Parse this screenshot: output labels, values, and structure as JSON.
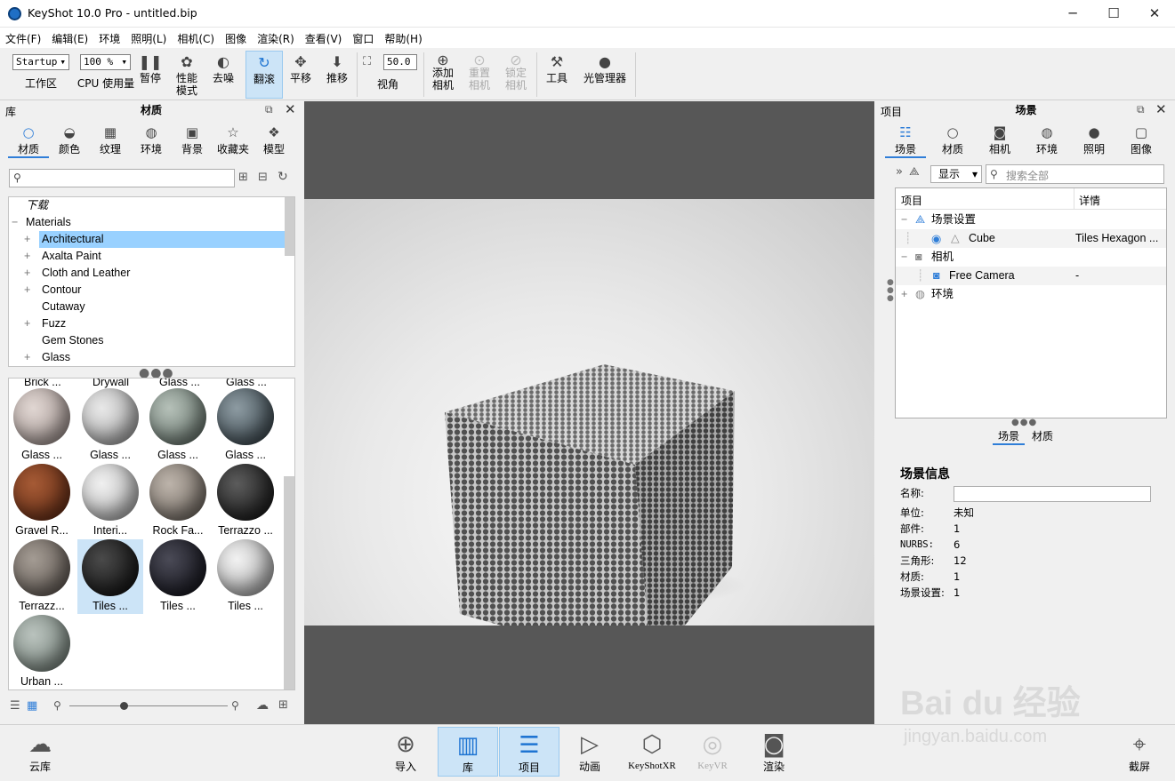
{
  "window": {
    "title": "KeyShot 10.0 Pro  - untitled.bip",
    "minimize": "─",
    "maximize": "☐",
    "close": "✕"
  },
  "menu": [
    "文件(F)",
    "编辑(E)",
    "环境",
    "照明(L)",
    "相机(C)",
    "图像",
    "渲染(R)",
    "查看(V)",
    "窗口",
    "帮助(H)"
  ],
  "toolbar": {
    "workspace_value": "Startup",
    "workspace_label": "工作区",
    "cpu_value": "100 %",
    "cpu_label": "CPU 使用量",
    "pause": "暂停",
    "perf_mode_1": "性能",
    "perf_mode_2": "模式",
    "denoise": "去噪",
    "flip": "翻滚",
    "pan": "平移",
    "dolly": "推移",
    "fov_value": "50.0",
    "fov_label": "视角",
    "add_camera_1": "添加",
    "add_camera_2": "相机",
    "reset_camera_1": "重置",
    "reset_camera_2": "相机",
    "lock_camera_1": "锁定",
    "lock_camera_2": "相机",
    "tools": "工具",
    "light_manager": "光管理器"
  },
  "library": {
    "header_left": "库",
    "title": "材质",
    "tabs": [
      "材质",
      "颜色",
      "纹理",
      "环境",
      "背景",
      "收藏夹",
      "模型"
    ],
    "search_placeholder": "",
    "tree": [
      {
        "label": "下载",
        "pm": ""
      },
      {
        "label": "Materials",
        "pm": "−"
      },
      {
        "label": "Architectural",
        "pm": "+"
      },
      {
        "label": "Axalta Paint",
        "pm": "+"
      },
      {
        "label": "Cloth and Leather",
        "pm": "+"
      },
      {
        "label": "Contour",
        "pm": "+"
      },
      {
        "label": "Cutaway",
        "pm": ""
      },
      {
        "label": "Fuzz",
        "pm": "+"
      },
      {
        "label": "Gem Stones",
        "pm": ""
      },
      {
        "label": "Glass",
        "pm": "+"
      }
    ],
    "top_row_labels": [
      "Brick ...",
      "Drywall",
      "Glass ...",
      "Glass ..."
    ],
    "thumbs": [
      "Glass ...",
      "Glass ...",
      "Glass ...",
      "Glass ...",
      "Gravel R...",
      "Interi...",
      "Rock Fa...",
      "Terrazzo ...",
      "Terrazz...",
      "Tiles ...",
      "Tiles ...",
      "Tiles ...",
      "Urban ..."
    ]
  },
  "project": {
    "header_left": "项目",
    "title": "场景",
    "tabs": [
      "场景",
      "材质",
      "相机",
      "环境",
      "照明",
      "图像"
    ],
    "show_value": "显示",
    "search_placeholder": "搜索全部",
    "col_item": "项目",
    "col_detail": "详情",
    "rows": {
      "scene_settings": "场景设置",
      "cube": "Cube",
      "cube_detail": "Tiles Hexagon ...",
      "cameras": "相机",
      "free_camera": "Free Camera",
      "free_camera_detail": "-",
      "environment": "环境"
    },
    "subtabs": [
      "场景",
      "材质"
    ],
    "info_title": "场景信息",
    "info": [
      {
        "k": "名称:",
        "v": ""
      },
      {
        "k": "单位:",
        "v": "未知"
      },
      {
        "k": "部件:",
        "v": "1"
      },
      {
        "k": "NURBS:",
        "v": "6"
      },
      {
        "k": "三角形:",
        "v": "12"
      },
      {
        "k": "材质:",
        "v": "1"
      },
      {
        "k": "场景设置:",
        "v": "1"
      }
    ]
  },
  "bottom": {
    "cloud": "云库",
    "import": "导入",
    "library": "库",
    "project": "项目",
    "animation": "动画",
    "keyshotxr": "KeyShotXR",
    "keyvr": "KeyVR",
    "render": "渲染",
    "screenshot": "截屏"
  },
  "watermark": {
    "brand": "Bai du 经验",
    "url": "jingyan.baidu.com"
  }
}
